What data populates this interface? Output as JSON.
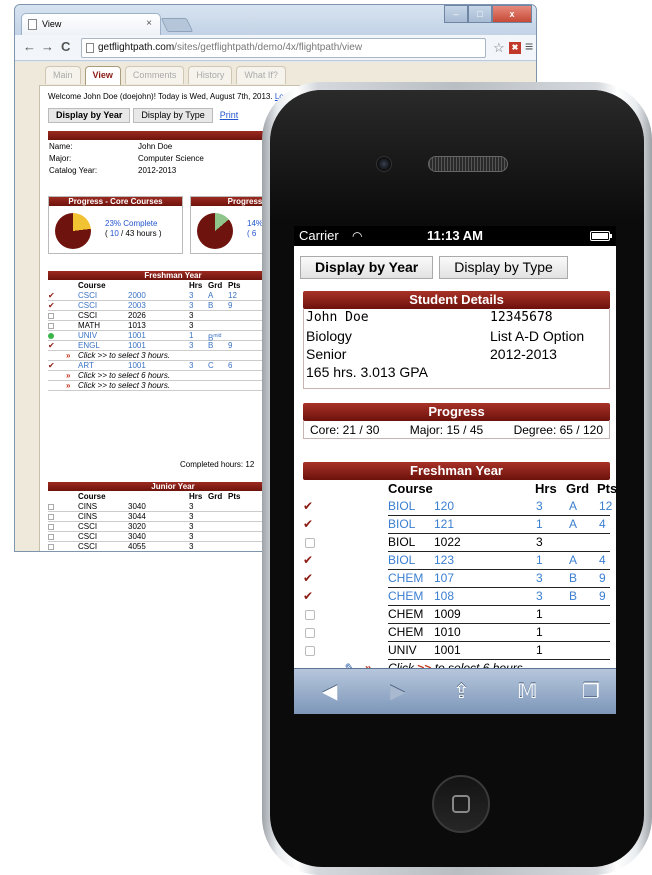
{
  "browser": {
    "tab_title": "View",
    "tab_close": "×",
    "window_minimize": "–",
    "window_maximize": "□",
    "window_close": "x",
    "back": "←",
    "forward": "→",
    "reload": "C",
    "url_host": "getflightpath.com",
    "url_path": "/sites/getflightpath/demo/4x/flightpath/view",
    "star": "☆",
    "extension": "✖",
    "menu": "≡"
  },
  "desktop": {
    "tabs": [
      "Main",
      "View",
      "Comments",
      "History",
      "What If?"
    ],
    "active_tab": "View",
    "welcome": "Welcome John Doe (doejohn)! Today is Wed, August 7th, 2013.",
    "logout": "Log out?",
    "btn_year": "Display by Year",
    "btn_type": "Display by Type",
    "print": "Print",
    "student_header": "Studen",
    "student": [
      {
        "k": "Name:",
        "v": "John Doe"
      },
      {
        "k": "Major:",
        "v": "Computer Science"
      },
      {
        "k": "Catalog Year:",
        "v": "2012-2013"
      }
    ],
    "progress_core_title": "Progress - Core Courses",
    "progress_core_pct": "23% Complete",
    "progress_core_hours_a": "( ",
    "progress_core_hours_num": "10",
    "progress_core_hours_b": " / 43 hours )",
    "progress_core_fraction": 0.23,
    "progress_major_title": "Progress",
    "progress_major_pct": "14%",
    "progress_major_hours": "( 6",
    "progress_major_fraction": 0.14,
    "freshman_title": "Freshman Year",
    "col_course": "Course",
    "col_hrs": "Hrs",
    "col_grd": "Grd",
    "col_pts": "Pts",
    "freshman_rows": [
      {
        "mark": "✔",
        "subj": "CSCI",
        "num": "2000",
        "hrs": "3",
        "grd": "A",
        "pts": "12",
        "blue": true
      },
      {
        "mark": "✔",
        "subj": "CSCI",
        "num": "2003",
        "hrs": "3",
        "grd": "B",
        "pts": "9",
        "blue": true
      },
      {
        "mark": "☐",
        "subj": "CSCI",
        "num": "2026",
        "hrs": "3",
        "grd": "",
        "pts": "",
        "blue": false
      },
      {
        "mark": "☐",
        "subj": "MATH",
        "num": "1013",
        "hrs": "3",
        "grd": "",
        "pts": "",
        "blue": false
      },
      {
        "mark": "●",
        "subj": "UNIV",
        "num": "1001",
        "hrs": "1",
        "grd": "B",
        "pts": "",
        "blue": true
      },
      {
        "mark": "✔",
        "subj": "ENGL",
        "num": "1001",
        "hrs": "3",
        "grd": "B",
        "pts": "9",
        "blue": true
      },
      {
        "note": "Click >> to select 3 hours."
      },
      {
        "mark": "✔",
        "subj": "ART",
        "num": "1001",
        "hrs": "3",
        "grd": "C",
        "pts": "6",
        "blue": true
      },
      {
        "note": "Click >> to select 6 hours."
      },
      {
        "note": "Click >> to select 3 hours."
      }
    ],
    "mid_superscript": "mid",
    "completed_hours": "Completed hours: 12",
    "junior_title": "Junior Year",
    "junior_rows": [
      {
        "subj": "CINS",
        "num": "3040",
        "hrs": "3"
      },
      {
        "subj": "CINS",
        "num": "3044",
        "hrs": "3"
      },
      {
        "subj": "CSCI",
        "num": "3020",
        "hrs": "3"
      },
      {
        "subj": "CSCI",
        "num": "3040",
        "hrs": "3"
      },
      {
        "subj": "CSCI",
        "num": "4055",
        "hrs": "3"
      }
    ],
    "junior_note": "Click >> to select 3 hours."
  },
  "phone": {
    "carrier": "Carrier",
    "wifi": "◠",
    "time": "11:13 AM",
    "btn_year": "Display by Year",
    "btn_type": "Display by Type",
    "student_details_title": "Student Details",
    "name": "John Doe",
    "id": "12345678",
    "major": "Biology",
    "option": "List A-D Option",
    "rank": "Senior",
    "catalog": "2012-2013",
    "gpa_line": "165 hrs. 3.013 GPA",
    "progress_title": "Progress",
    "core": "Core: 21 / 30",
    "major_prog": "Major: 15 / 45",
    "degree": "Degree: 65 / 120",
    "freshman_title": "Freshman Year",
    "col_course": "Course",
    "col_hrs": "Hrs",
    "col_grd": "Grd",
    "col_pts": "Pts",
    "rows": [
      {
        "check": true,
        "subj": "BIOL",
        "num": "120",
        "hrs": "3",
        "grd": "A",
        "pts": "12",
        "blue": true
      },
      {
        "check": true,
        "subj": "BIOL",
        "num": "121",
        "hrs": "1",
        "grd": "A",
        "pts": "4",
        "blue": true
      },
      {
        "check": false,
        "subj": "BIOL",
        "num": "1022",
        "hrs": "3",
        "grd": "",
        "pts": "",
        "blue": false
      },
      {
        "check": true,
        "subj": "BIOL",
        "num": "123",
        "hrs": "1",
        "grd": "A",
        "pts": "4",
        "blue": true
      },
      {
        "check": true,
        "subj": "CHEM",
        "num": "107",
        "hrs": "3",
        "grd": "B",
        "pts": "9",
        "blue": true
      },
      {
        "check": true,
        "subj": "CHEM",
        "num": "108",
        "hrs": "3",
        "grd": "B",
        "pts": "9",
        "blue": true
      },
      {
        "check": false,
        "subj": "CHEM",
        "num": "1009",
        "hrs": "1",
        "grd": "",
        "pts": "",
        "blue": false
      },
      {
        "check": false,
        "subj": "CHEM",
        "num": "1010",
        "hrs": "1",
        "grd": "",
        "pts": "",
        "blue": false
      },
      {
        "check": false,
        "subj": "UNIV",
        "num": "1001",
        "hrs": "1",
        "grd": "",
        "pts": "",
        "blue": false
      }
    ],
    "note_click": "Click",
    "note_arrows": ">>",
    "note_rest": "to select 6 hours.",
    "toolbar": {
      "back": "◀",
      "forward": "▶",
      "share": "⇪",
      "bookmarks": "𝕄",
      "tabs": "❐"
    }
  },
  "colors": {
    "accent": "#8c1b14",
    "link": "#3b7fd1",
    "toolbar": "#7d97b9"
  }
}
